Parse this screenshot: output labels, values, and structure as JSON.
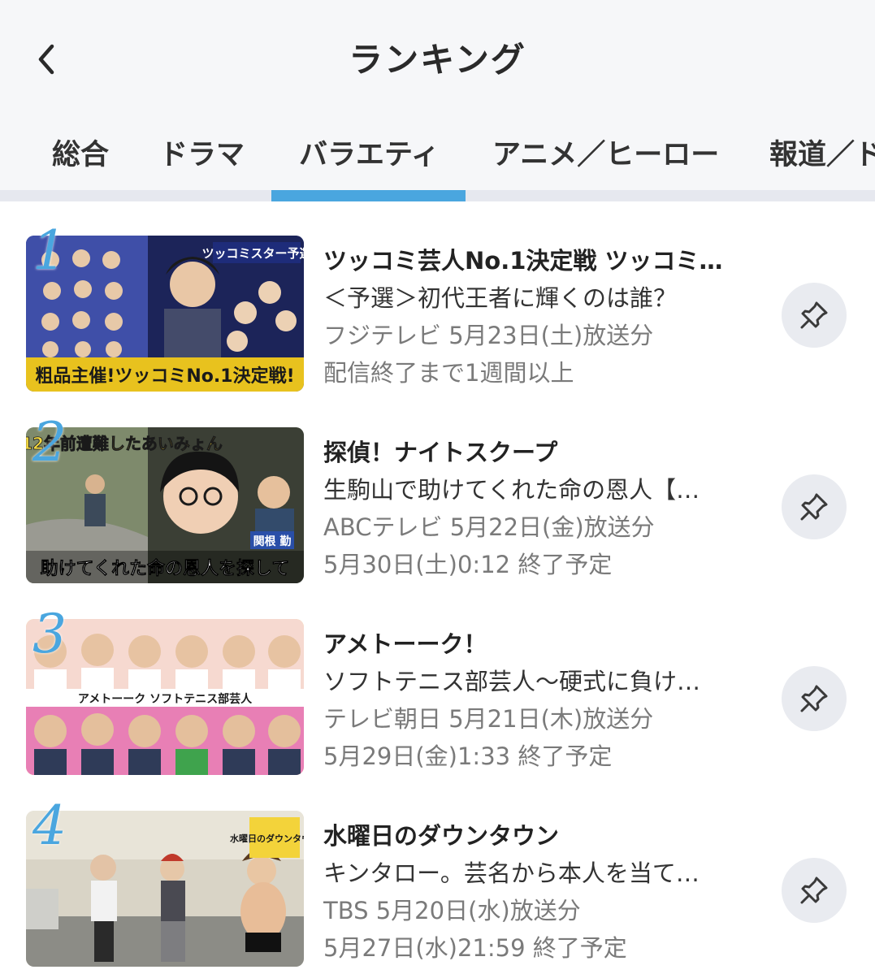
{
  "header": {
    "title": "ランキング",
    "back_icon": "chevron-left-icon"
  },
  "tabs": [
    {
      "label": "総合",
      "active": false
    },
    {
      "label": "ドラマ",
      "active": false
    },
    {
      "label": "バラエティ",
      "active": true
    },
    {
      "label": "アニメ／ヒーロー",
      "active": false
    },
    {
      "label": "報道／ド",
      "active": false
    }
  ],
  "accent_color": "#4aa6df",
  "items": [
    {
      "rank": "1",
      "title": "ツッコミ芸人No.1決定戦 ツッコミ…",
      "subtitle": "＜予選＞初代王者に輝くのは誰？",
      "broadcast": "フジテレビ 5月23日(土)放送分",
      "availability": "配信終了まで1週間以上",
      "thumb_caption": "粗品主催!ツッコミNo.1決定戦!",
      "thumb_badge": "ツッコミスター予選"
    },
    {
      "rank": "2",
      "title": "探偵！ナイトスクープ",
      "subtitle": "生駒山で助けてくれた命の恩人【…",
      "broadcast": "ABCテレビ 5月22日(金)放送分",
      "availability": "5月30日(土)0:12 終了予定",
      "thumb_caption": "助けてくれた命の恩人を探して",
      "thumb_badge": "12年前遭難したあいみょん",
      "thumb_name": "関根 勤"
    },
    {
      "rank": "3",
      "title": "アメトーーク！",
      "subtitle": "ソフトテニス部芸人〜硬式に負け…",
      "broadcast": "テレビ朝日 5月21日(木)放送分",
      "availability": "5月29日(金)1:33 終了予定",
      "thumb_caption": "アメトーーク ソフトテニス部芸人"
    },
    {
      "rank": "4",
      "title": "水曜日のダウンタウン",
      "subtitle": "キンタロー。芸名から本人を当て…",
      "broadcast": "TBS 5月20日(水)放送分",
      "availability": "5月27日(水)21:59 終了予定",
      "thumb_badge": "水曜日のダウンタウン"
    }
  ],
  "pin_icon": "pin-icon"
}
